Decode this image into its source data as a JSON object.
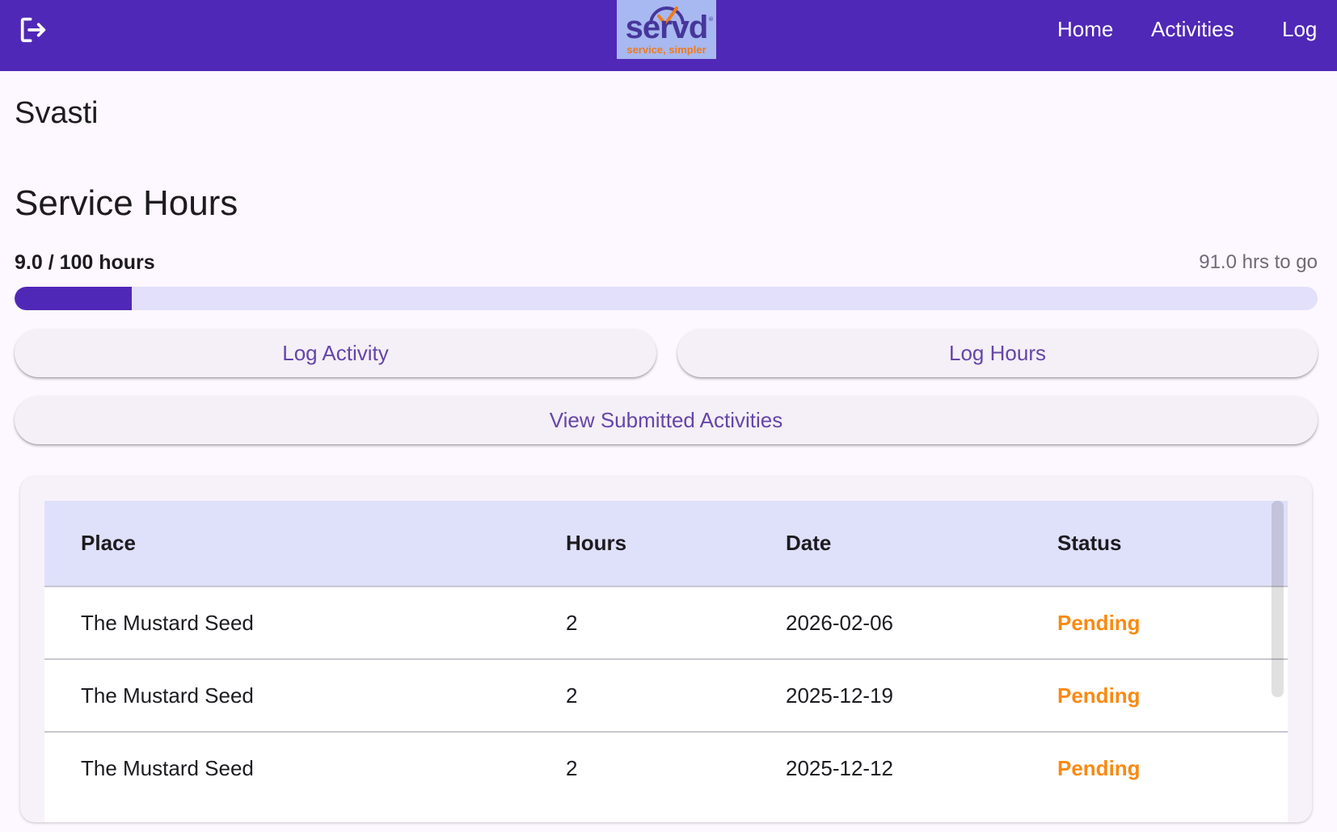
{
  "header": {
    "exit_icon": "logout-icon",
    "logo": {
      "word": "servd",
      "registered": "®",
      "tagline": "service, simpler"
    },
    "nav": [
      "Home",
      "Activities",
      "Log"
    ]
  },
  "user": {
    "name": "Svasti"
  },
  "service_hours": {
    "title": "Service Hours",
    "progress_text": "9.0 / 100 hours",
    "remaining_text": "91.0 hrs to go",
    "completed": 9.0,
    "goal": 100
  },
  "actions": {
    "log_activity": "Log Activity",
    "log_hours": "Log Hours",
    "view_submitted": "View Submitted Activities"
  },
  "table": {
    "columns": [
      "Place",
      "Hours",
      "Date",
      "Status"
    ],
    "rows": [
      {
        "place": "The Mustard Seed",
        "hours": "2",
        "date": "2026-02-06",
        "status": "Pending"
      },
      {
        "place": "The Mustard Seed",
        "hours": "2",
        "date": "2025-12-19",
        "status": "Pending"
      },
      {
        "place": "The Mustard Seed",
        "hours": "2",
        "date": "2025-12-12",
        "status": "Pending"
      }
    ]
  },
  "colors": {
    "primary": "#5028b7",
    "status_pending": "#f98a12",
    "progress_track": "#e2e0fa",
    "table_header": "#dfe0fa"
  }
}
